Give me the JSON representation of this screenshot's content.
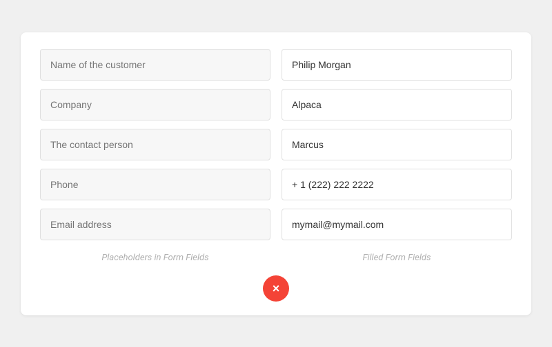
{
  "card": {
    "form": {
      "rows": [
        {
          "placeholder": "Name of the customer",
          "filled_value": "Philip Morgan"
        },
        {
          "placeholder": "Company",
          "filled_value": "Alpaca"
        },
        {
          "placeholder": "The contact person",
          "filled_value": "Marcus"
        },
        {
          "placeholder": "Phone",
          "filled_value": "+ 1 (222) 222 2222"
        },
        {
          "placeholder": "Email address",
          "filled_value": "mymail@mymail.com"
        }
      ],
      "label_left": "Placeholders in Form Fields",
      "label_right": "Filled Form Fields"
    },
    "close_button_label": "×"
  }
}
